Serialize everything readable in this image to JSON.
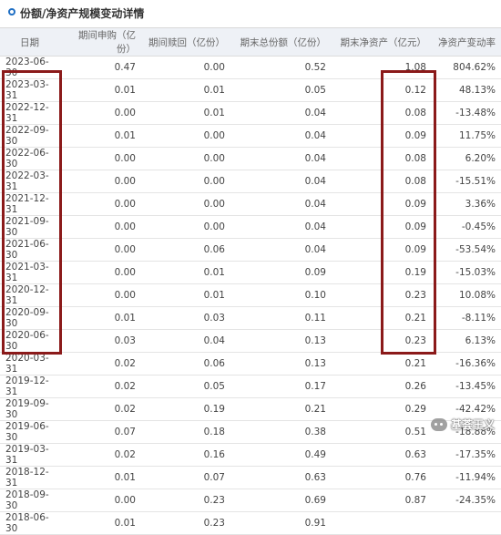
{
  "panel": {
    "title": "份额/净资产规模变动详情"
  },
  "table": {
    "headers": [
      "日期",
      "期间申购（亿份）",
      "期间赎回（亿份）",
      "期末总份额（亿份）",
      "期末净资产（亿元）",
      "净资产变动率"
    ],
    "rows": [
      [
        "2023-06-30",
        "0.47",
        "0.00",
        "0.52",
        "1.08",
        "804.62%"
      ],
      [
        "2023-03-31",
        "0.01",
        "0.01",
        "0.05",
        "0.12",
        "48.13%"
      ],
      [
        "2022-12-31",
        "0.00",
        "0.01",
        "0.04",
        "0.08",
        "-13.48%"
      ],
      [
        "2022-09-30",
        "0.01",
        "0.00",
        "0.04",
        "0.09",
        "11.75%"
      ],
      [
        "2022-06-30",
        "0.00",
        "0.00",
        "0.04",
        "0.08",
        "6.20%"
      ],
      [
        "2022-03-31",
        "0.00",
        "0.00",
        "0.04",
        "0.08",
        "-15.51%"
      ],
      [
        "2021-12-31",
        "0.00",
        "0.00",
        "0.04",
        "0.09",
        "3.36%"
      ],
      [
        "2021-09-30",
        "0.00",
        "0.00",
        "0.04",
        "0.09",
        "-0.45%"
      ],
      [
        "2021-06-30",
        "0.00",
        "0.06",
        "0.04",
        "0.09",
        "-53.54%"
      ],
      [
        "2021-03-31",
        "0.00",
        "0.01",
        "0.09",
        "0.19",
        "-15.03%"
      ],
      [
        "2020-12-31",
        "0.00",
        "0.01",
        "0.10",
        "0.23",
        "10.08%"
      ],
      [
        "2020-09-30",
        "0.01",
        "0.03",
        "0.11",
        "0.21",
        "-8.11%"
      ],
      [
        "2020-06-30",
        "0.03",
        "0.04",
        "0.13",
        "0.23",
        "6.13%"
      ],
      [
        "2020-03-31",
        "0.02",
        "0.06",
        "0.13",
        "0.21",
        "-16.36%"
      ],
      [
        "2019-12-31",
        "0.02",
        "0.05",
        "0.17",
        "0.26",
        "-13.45%"
      ],
      [
        "2019-09-30",
        "0.02",
        "0.19",
        "0.21",
        "0.29",
        "-42.42%"
      ],
      [
        "2019-06-30",
        "0.07",
        "0.18",
        "0.38",
        "0.51",
        "-18.88%"
      ],
      [
        "2019-03-31",
        "0.02",
        "0.16",
        "0.49",
        "0.63",
        "-17.35%"
      ],
      [
        "2018-12-31",
        "0.01",
        "0.07",
        "0.63",
        "0.76",
        "-11.94%"
      ],
      [
        "2018-09-30",
        "0.00",
        "0.23",
        "0.69",
        "0.87",
        "-24.35%"
      ],
      [
        "2018-06-30",
        "0.01",
        "0.23",
        "0.91",
        "",
        ""
      ]
    ]
  },
  "highlight_color": "#8b1a1a",
  "watermark": {
    "text": "基荟王义",
    "icon": "wechat-icon"
  }
}
